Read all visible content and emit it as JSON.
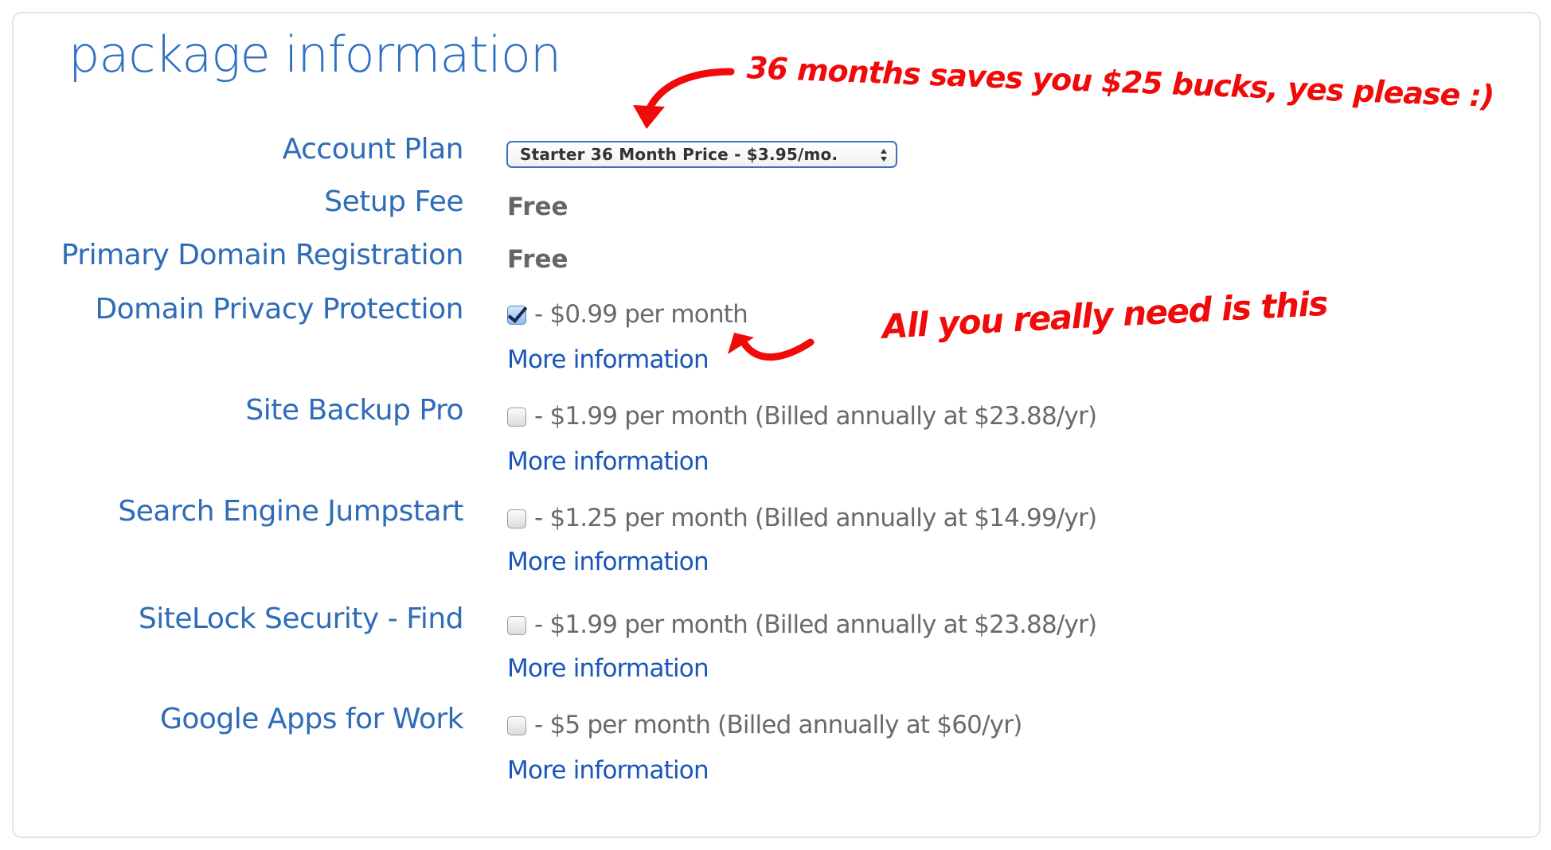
{
  "section": {
    "title": "package information"
  },
  "account_plan": {
    "label": "Account Plan",
    "selected": "Starter 36 Month Price - $3.95/mo."
  },
  "setup_fee": {
    "label": "Setup Fee",
    "value": "Free"
  },
  "primary_domain": {
    "label": "Primary Domain Registration",
    "value": "Free"
  },
  "addons": [
    {
      "label": "Domain Privacy Protection",
      "checked": true,
      "price_text": "- $0.99 per month",
      "more_link": "More information"
    },
    {
      "label": "Site Backup Pro",
      "checked": false,
      "price_text": "- $1.99 per month (Billed annually at $23.88/yr)",
      "more_link": "More information"
    },
    {
      "label": "Search Engine Jumpstart",
      "checked": false,
      "price_text": "- $1.25 per month (Billed annually at $14.99/yr)",
      "more_link": "More information"
    },
    {
      "label": "SiteLock Security - Find",
      "checked": false,
      "price_text": "- $1.99 per month (Billed annually at $23.88/yr)",
      "more_link": "More information"
    },
    {
      "label": "Google Apps for Work",
      "checked": false,
      "price_text": "- $5 per month (Billed annually at $60/yr)",
      "more_link": "More information"
    }
  ],
  "annotations": {
    "top_note": "36 months saves you $25 bucks, yes please :)",
    "side_note": "All you really need is this",
    "color": "#f00a0a"
  },
  "colors": {
    "label_blue": "#2f6cb8",
    "link_blue": "#1a56b8",
    "value_gray": "#666666",
    "panel_border": "#dbe7f6"
  }
}
